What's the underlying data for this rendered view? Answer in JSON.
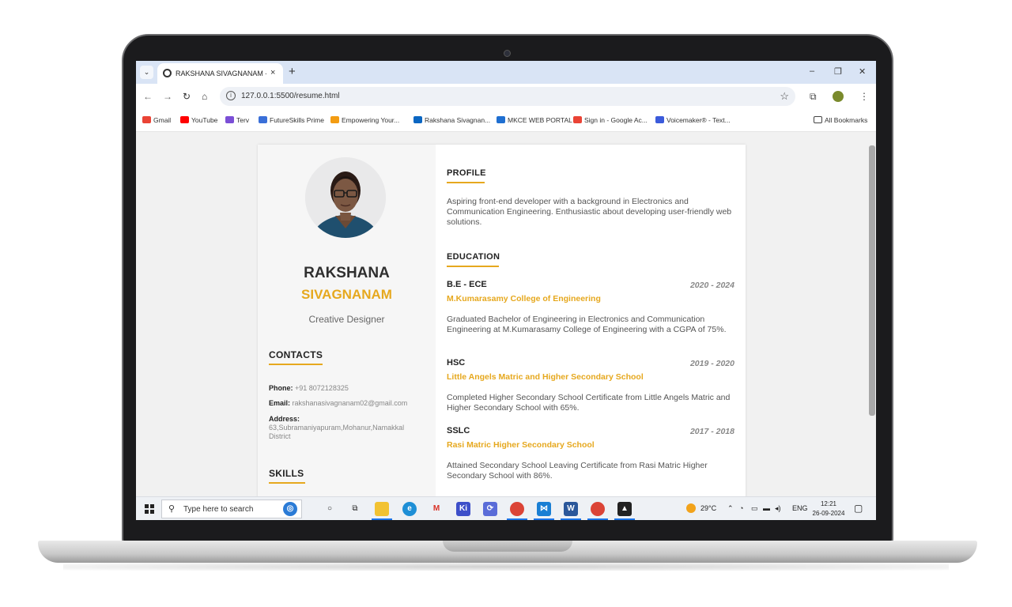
{
  "browser": {
    "tab_title": "RAKSHANA SIVAGNANAM - Re",
    "tab_close": "×",
    "new_tab": "+",
    "url": "127.0.0.1:5500/resume.html",
    "window_minimize": "–",
    "window_restore": "❐",
    "window_close": "✕",
    "bookmarks": [
      "Gmail",
      "YouTube",
      "Terv",
      "FutureSkills Prime",
      "Empowering Your...",
      "Rakshana Sivagnan...",
      "MKCE WEB PORTAL",
      "Sign in - Google Ac...",
      "Voicemaker® - Text..."
    ],
    "all_bookmarks": "All Bookmarks"
  },
  "resume": {
    "first_name": "RAKSHANA",
    "last_name": "SIVAGNANAM",
    "role": "Creative Designer",
    "contacts_title": "CONTACTS",
    "phone_label": "Phone:",
    "phone": "+91 8072128325",
    "email_label": "Email:",
    "email": "rakshanasivagnanam02@gmail.com",
    "address_label": "Address:",
    "address": "63,Subramaniyapuram,Mohanur,Namakkal District",
    "skills_title": "SKILLS",
    "profile_title": "PROFILE",
    "profile_text": "Aspiring front-end developer with a background in Electronics and Communication Engineering. Enthusiastic about developing user-friendly web solutions.",
    "education_title": "EDUCATION",
    "education": [
      {
        "degree": "B.E - ECE",
        "years": "2020 - 2024",
        "institution": "M.Kumarasamy College of Engineering",
        "description": "Graduated Bachelor of Engineering in Electronics and Communication Engineering at M.Kumarasamy College of Engineering with a CGPA of 75%."
      },
      {
        "degree": "HSC",
        "years": "2019 - 2020",
        "institution": "Little Angels Matric and Higher Secondary School",
        "description": "Completed Higher Secondary School Certificate from Little Angels Matric and Higher Secondary School with 65%."
      },
      {
        "degree": "SSLC",
        "years": "2017 - 2018",
        "institution": "Rasi Matric Higher Secondary School",
        "description": "Attained Secondary School Leaving Certificate from Rasi Matric Higher Secondary School with 86%."
      }
    ]
  },
  "taskbar": {
    "search_placeholder": "Type here to search",
    "weather": "29°C",
    "language": "ENG",
    "time": "12:21",
    "date": "26-09-2024"
  },
  "colors": {
    "accent": "#e6a81e",
    "chrome_tabbar": "#d9e4f5"
  },
  "icons": [
    "tab-list-icon",
    "globe-icon",
    "back-icon",
    "forward-icon",
    "reload-icon",
    "home-icon",
    "site-info-icon",
    "bookmark-star-icon",
    "extensions-icon",
    "profile-icon",
    "menu-icon",
    "folder-icon",
    "windows-logo-icon",
    "search-icon",
    "notification-icon"
  ]
}
